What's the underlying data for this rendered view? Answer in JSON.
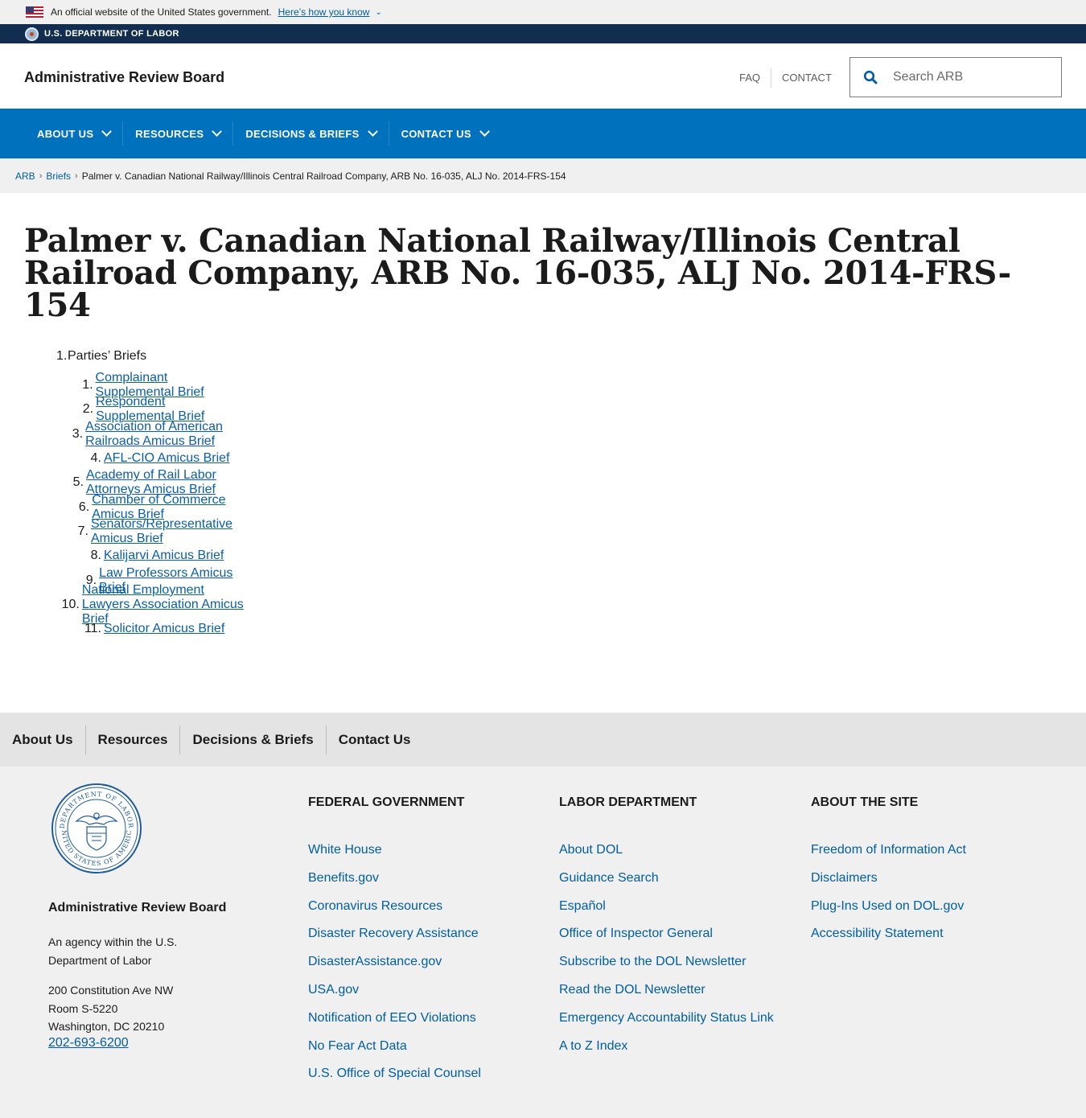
{
  "gov_banner": {
    "text": "An official website of the United States government.",
    "link": "Here’s how you know"
  },
  "dol_bar": {
    "text": "U.S. DEPARTMENT OF LABOR"
  },
  "header": {
    "site_title": "Administrative Review Board",
    "faq": "FAQ",
    "contact": "CONTACT",
    "search_placeholder": "Search ARB"
  },
  "main_nav": [
    {
      "label": "ABOUT US"
    },
    {
      "label": "RESOURCES"
    },
    {
      "label": "DECISIONS & BRIEFS"
    },
    {
      "label": "CONTACT US"
    }
  ],
  "breadcrumb": {
    "items": [
      "ARB",
      "Briefs"
    ],
    "current": "Palmer v. Canadian National Railway/Illinois Central Railroad Company, ARB No. 16-035, ALJ No. 2014-FRS-154"
  },
  "page_title": "Palmer v. Canadian National Railway/Illinois Central Railroad Company, ARB No. 16-035, ALJ No. 2014-FRS-154",
  "briefs": {
    "section_number": "1.",
    "section_label": "Parties’ Briefs",
    "items": [
      {
        "num": "1.",
        "label": "Complainant Supplemental Brief"
      },
      {
        "num": "2.",
        "label": "Respondent Supplemental Brief"
      },
      {
        "num": "3.",
        "label": "Association of American Railroads Amicus Brief"
      },
      {
        "num": "4.",
        "label": "AFL-CIO Amicus Brief"
      },
      {
        "num": "5.",
        "label": "Academy of Rail Labor Attorneys Amicus Brief"
      },
      {
        "num": "6.",
        "label": "Chamber of Commerce Amicus Brief"
      },
      {
        "num": "7.",
        "label": "Senators/Representative Amicus Brief"
      },
      {
        "num": "8.",
        "label": "Kalijarvi Amicus Brief"
      },
      {
        "num": "9.",
        "label": "Law Professors Amicus Brief"
      },
      {
        "num": "10.",
        "label": "National Employment Lawyers Association Amicus Brief"
      },
      {
        "num": "11.",
        "label": "Solicitor Amicus Brief"
      }
    ]
  },
  "footer_nav": [
    {
      "label": "About Us"
    },
    {
      "label": "Resources"
    },
    {
      "label": "Decisions & Briefs"
    },
    {
      "label": "Contact Us"
    }
  ],
  "footer": {
    "org_name": "Administrative Review Board",
    "agency_line1": "An agency within the U.S.",
    "agency_line2": "Department of Labor",
    "address_line1": "200 Constitution Ave NW",
    "address_line2": "Room S-5220",
    "address_line3": "Washington, DC 20210",
    "phone": "202-693-6200",
    "seal_text": "DEPARTMENT OF LABOR · UNITED STATES OF AMERICA",
    "columns": [
      {
        "title": "FEDERAL GOVERNMENT",
        "links": [
          "White House",
          "Benefits.gov",
          "Coronavirus Resources",
          "Disaster Recovery Assistance",
          "DisasterAssistance.gov",
          "USA.gov",
          "Notification of EEO Violations",
          "No Fear Act Data",
          "U.S. Office of Special Counsel"
        ]
      },
      {
        "title": "LABOR DEPARTMENT",
        "links": [
          "About DOL",
          "Guidance Search",
          "Español",
          "Office of Inspector General",
          "Subscribe to the DOL Newsletter",
          "Read the DOL Newsletter",
          "Emergency Accountability Status Link",
          "A to Z Index"
        ]
      },
      {
        "title": "ABOUT THE SITE",
        "links": [
          "Freedom of Information Act",
          "Disclaimers",
          "Plug-Ins Used on DOL.gov",
          "Accessibility Statement"
        ]
      }
    ]
  },
  "colors": {
    "primary_blue": "#0071bc",
    "dark_navy": "#112e51",
    "link_blue": "#005ea2"
  }
}
